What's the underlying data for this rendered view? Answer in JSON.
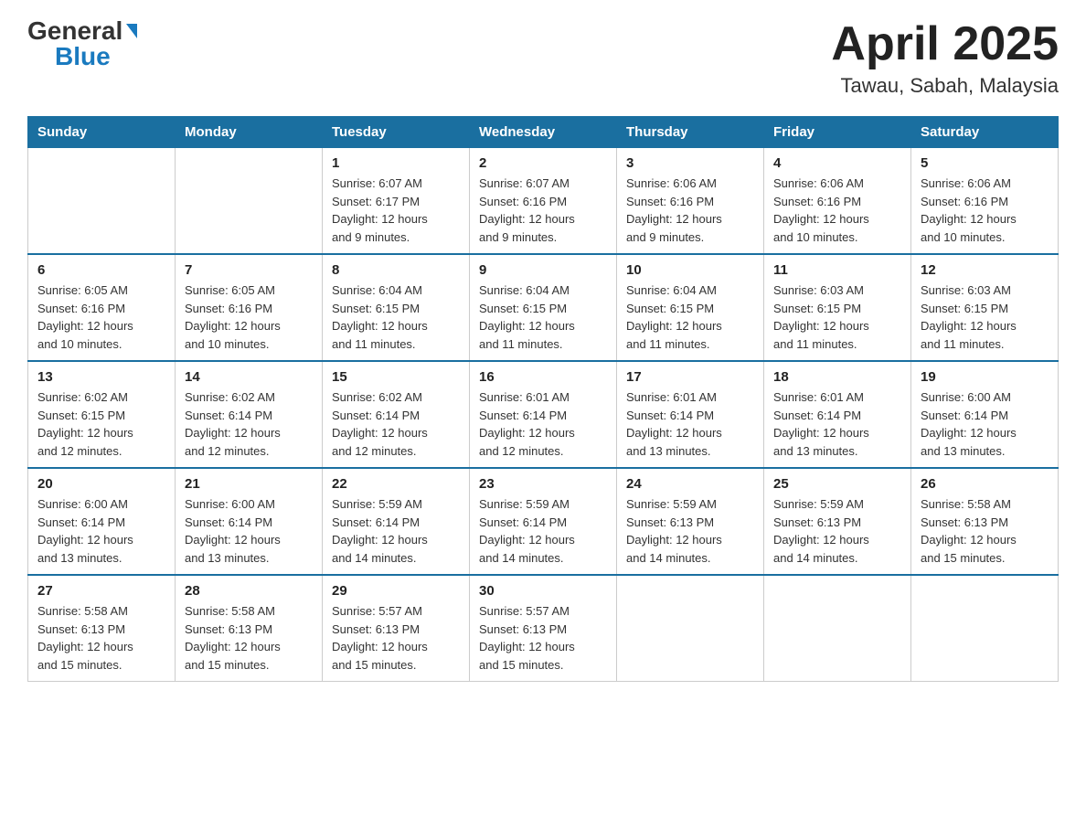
{
  "logo": {
    "general": "General",
    "blue": "Blue"
  },
  "title": {
    "month_year": "April 2025",
    "location": "Tawau, Sabah, Malaysia"
  },
  "headers": [
    "Sunday",
    "Monday",
    "Tuesday",
    "Wednesday",
    "Thursday",
    "Friday",
    "Saturday"
  ],
  "weeks": [
    [
      {
        "day": "",
        "info": ""
      },
      {
        "day": "",
        "info": ""
      },
      {
        "day": "1",
        "info": "Sunrise: 6:07 AM\nSunset: 6:17 PM\nDaylight: 12 hours\nand 9 minutes."
      },
      {
        "day": "2",
        "info": "Sunrise: 6:07 AM\nSunset: 6:16 PM\nDaylight: 12 hours\nand 9 minutes."
      },
      {
        "day": "3",
        "info": "Sunrise: 6:06 AM\nSunset: 6:16 PM\nDaylight: 12 hours\nand 9 minutes."
      },
      {
        "day": "4",
        "info": "Sunrise: 6:06 AM\nSunset: 6:16 PM\nDaylight: 12 hours\nand 10 minutes."
      },
      {
        "day": "5",
        "info": "Sunrise: 6:06 AM\nSunset: 6:16 PM\nDaylight: 12 hours\nand 10 minutes."
      }
    ],
    [
      {
        "day": "6",
        "info": "Sunrise: 6:05 AM\nSunset: 6:16 PM\nDaylight: 12 hours\nand 10 minutes."
      },
      {
        "day": "7",
        "info": "Sunrise: 6:05 AM\nSunset: 6:16 PM\nDaylight: 12 hours\nand 10 minutes."
      },
      {
        "day": "8",
        "info": "Sunrise: 6:04 AM\nSunset: 6:15 PM\nDaylight: 12 hours\nand 11 minutes."
      },
      {
        "day": "9",
        "info": "Sunrise: 6:04 AM\nSunset: 6:15 PM\nDaylight: 12 hours\nand 11 minutes."
      },
      {
        "day": "10",
        "info": "Sunrise: 6:04 AM\nSunset: 6:15 PM\nDaylight: 12 hours\nand 11 minutes."
      },
      {
        "day": "11",
        "info": "Sunrise: 6:03 AM\nSunset: 6:15 PM\nDaylight: 12 hours\nand 11 minutes."
      },
      {
        "day": "12",
        "info": "Sunrise: 6:03 AM\nSunset: 6:15 PM\nDaylight: 12 hours\nand 11 minutes."
      }
    ],
    [
      {
        "day": "13",
        "info": "Sunrise: 6:02 AM\nSunset: 6:15 PM\nDaylight: 12 hours\nand 12 minutes."
      },
      {
        "day": "14",
        "info": "Sunrise: 6:02 AM\nSunset: 6:14 PM\nDaylight: 12 hours\nand 12 minutes."
      },
      {
        "day": "15",
        "info": "Sunrise: 6:02 AM\nSunset: 6:14 PM\nDaylight: 12 hours\nand 12 minutes."
      },
      {
        "day": "16",
        "info": "Sunrise: 6:01 AM\nSunset: 6:14 PM\nDaylight: 12 hours\nand 12 minutes."
      },
      {
        "day": "17",
        "info": "Sunrise: 6:01 AM\nSunset: 6:14 PM\nDaylight: 12 hours\nand 13 minutes."
      },
      {
        "day": "18",
        "info": "Sunrise: 6:01 AM\nSunset: 6:14 PM\nDaylight: 12 hours\nand 13 minutes."
      },
      {
        "day": "19",
        "info": "Sunrise: 6:00 AM\nSunset: 6:14 PM\nDaylight: 12 hours\nand 13 minutes."
      }
    ],
    [
      {
        "day": "20",
        "info": "Sunrise: 6:00 AM\nSunset: 6:14 PM\nDaylight: 12 hours\nand 13 minutes."
      },
      {
        "day": "21",
        "info": "Sunrise: 6:00 AM\nSunset: 6:14 PM\nDaylight: 12 hours\nand 13 minutes."
      },
      {
        "day": "22",
        "info": "Sunrise: 5:59 AM\nSunset: 6:14 PM\nDaylight: 12 hours\nand 14 minutes."
      },
      {
        "day": "23",
        "info": "Sunrise: 5:59 AM\nSunset: 6:14 PM\nDaylight: 12 hours\nand 14 minutes."
      },
      {
        "day": "24",
        "info": "Sunrise: 5:59 AM\nSunset: 6:13 PM\nDaylight: 12 hours\nand 14 minutes."
      },
      {
        "day": "25",
        "info": "Sunrise: 5:59 AM\nSunset: 6:13 PM\nDaylight: 12 hours\nand 14 minutes."
      },
      {
        "day": "26",
        "info": "Sunrise: 5:58 AM\nSunset: 6:13 PM\nDaylight: 12 hours\nand 15 minutes."
      }
    ],
    [
      {
        "day": "27",
        "info": "Sunrise: 5:58 AM\nSunset: 6:13 PM\nDaylight: 12 hours\nand 15 minutes."
      },
      {
        "day": "28",
        "info": "Sunrise: 5:58 AM\nSunset: 6:13 PM\nDaylight: 12 hours\nand 15 minutes."
      },
      {
        "day": "29",
        "info": "Sunrise: 5:57 AM\nSunset: 6:13 PM\nDaylight: 12 hours\nand 15 minutes."
      },
      {
        "day": "30",
        "info": "Sunrise: 5:57 AM\nSunset: 6:13 PM\nDaylight: 12 hours\nand 15 minutes."
      },
      {
        "day": "",
        "info": ""
      },
      {
        "day": "",
        "info": ""
      },
      {
        "day": "",
        "info": ""
      }
    ]
  ]
}
